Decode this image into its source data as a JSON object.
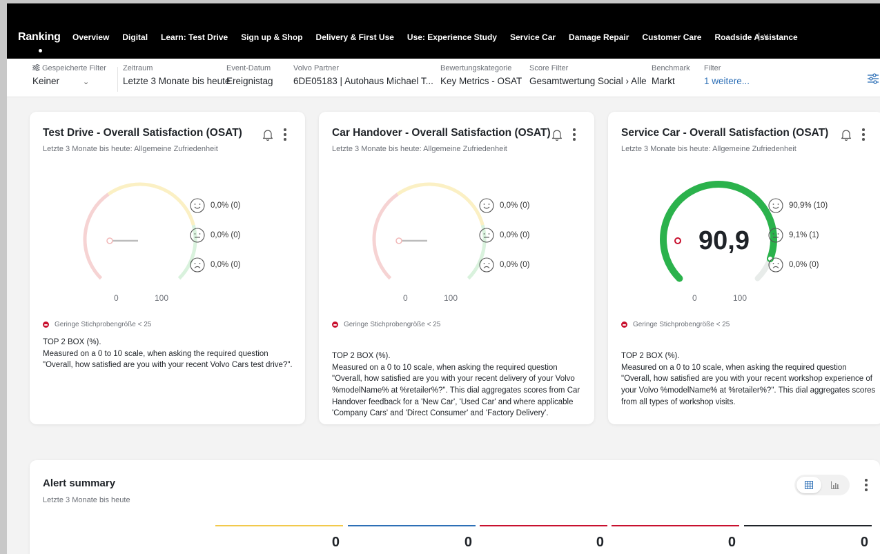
{
  "nav": {
    "brand": "Ranking",
    "items": [
      "Overview",
      "Digital",
      "Learn: Test Drive",
      "Sign up & Shop",
      "Delivery & First Use",
      "Use: Experience Study",
      "Service Car",
      "Damage Repair",
      "Customer Care",
      "Roadside Assistance"
    ],
    "more": "| ∨"
  },
  "filters": {
    "saved": {
      "label": "Gespeicherte Filter",
      "value": "Keiner"
    },
    "period": {
      "label": "Zeitraum",
      "value": "Letzte 3 Monate bis heute"
    },
    "event_date": {
      "label": "Event-Datum",
      "value": "Ereignistag"
    },
    "partner": {
      "label": "Volvo Partner",
      "value": "6DE05183 | Autohaus Michael T..."
    },
    "category": {
      "label": "Bewertungskategorie",
      "value": "Key Metrics - OSAT"
    },
    "score_filter": {
      "label": "Score Filter",
      "value": "Gesamtwertung Social › Alle"
    },
    "benchmark": {
      "label": "Benchmark",
      "value": "Markt"
    },
    "filter": {
      "label": "Filter",
      "value": "1 weitere..."
    }
  },
  "cards": [
    {
      "title": "Test Drive - Overall Satisfaction (OSAT)",
      "subtitle": "Letzte 3 Monate bis heute: Allgemeine Zufriedenheit",
      "score": "",
      "score_fraction": 0,
      "gauge_min": "0",
      "gauge_max": "100",
      "positive": "0,0% (0)",
      "neutral": "0,0% (0)",
      "negative": "0,0% (0)",
      "legend": "Geringe Stichprobengröße < 25",
      "desc_title": "TOP 2 BOX (%).",
      "desc_body": "Measured on a 0 to 10 scale, when asking the required question \"Overall, how satisfied are you with your recent Volvo Cars test drive?\"."
    },
    {
      "title": "Car Handover - Overall Satisfaction (OSAT)",
      "subtitle": "Letzte 3 Monate bis heute: Allgemeine Zufriedenheit",
      "score": "",
      "score_fraction": 0,
      "gauge_min": "0",
      "gauge_max": "100",
      "positive": "0,0% (0)",
      "neutral": "0,0% (0)",
      "negative": "0,0% (0)",
      "legend": "Geringe Stichprobengröße < 25",
      "desc_title": "TOP 2 BOX (%).",
      "desc_body": "Measured on a 0 to 10 scale, when asking the required question \"Overall, how satisfied are you with your recent delivery of your Volvo %modelName% at %retailer%?\". This dial aggregates scores from Car Handover feedback for a 'New Car', 'Used Car' and where applicable 'Company Cars' and 'Direct Consumer' and 'Factory Delivery'."
    },
    {
      "title": "Service Car - Overall Satisfaction (OSAT)",
      "subtitle": "Letzte 3 Monate bis heute: Allgemeine Zufriedenheit",
      "score": "90,9",
      "score_fraction": 0.909,
      "gauge_min": "0",
      "gauge_max": "100",
      "positive": "90,9% (10)",
      "neutral": "9,1% (1)",
      "negative": "0,0% (0)",
      "legend": "Geringe Stichprobengröße < 25",
      "desc_title": "TOP 2 BOX (%).",
      "desc_body": "Measured on a 0 to 10 scale, when asking the required question \"Overall, how satisfied are you with your recent workshop experience of your Volvo %modelName% at %retailer%?\". This dial aggregates scores from all types of workshop visits."
    }
  ],
  "alert_summary": {
    "title": "Alert summary",
    "subtitle": "Letzte 3 Monate bis heute",
    "metrics": [
      {
        "value": "0",
        "color": "#f2c94c"
      },
      {
        "value": "0",
        "color": "#2d6fb6"
      },
      {
        "value": "0",
        "color": "#c8102e"
      },
      {
        "value": "0",
        "color": "#c8102e"
      },
      {
        "value": "0",
        "color": "#1f2328"
      }
    ]
  },
  "colors": {
    "accent": "#2d6fb6",
    "gauge_green": "#2bb24c",
    "gauge_red_zone": "#f6d3d3",
    "gauge_yellow_zone": "#fbf0c4",
    "gauge_green_zone": "#d9f2dd",
    "low_sample": "#c8102e"
  }
}
